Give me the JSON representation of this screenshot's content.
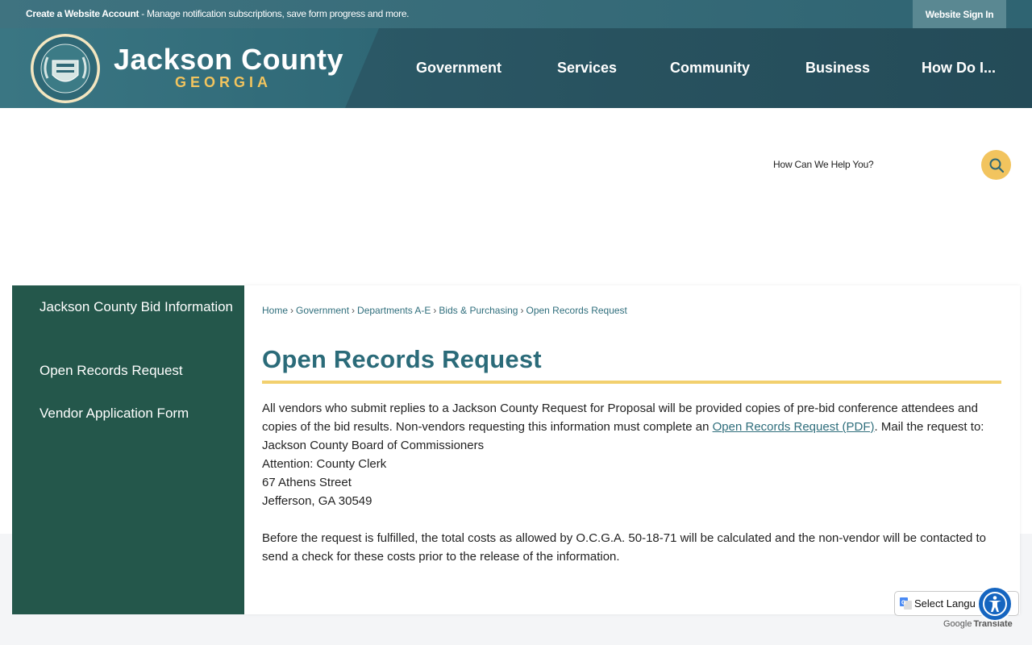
{
  "topbar": {
    "message_strong": "Create a Website Account",
    "message_rest": " - Manage notification subscriptions, save form progress and more.",
    "signin_label": "Website Sign In"
  },
  "header": {
    "brand_name": "Jackson County",
    "brand_state": "GEORGIA",
    "nav": [
      {
        "label": "Government"
      },
      {
        "label": "Services"
      },
      {
        "label": "Community"
      },
      {
        "label": "Business"
      },
      {
        "label": "How Do I..."
      }
    ]
  },
  "search": {
    "placeholder": "How Can We Help You?"
  },
  "sidebar": {
    "items": [
      {
        "label": "Jackson County Bid Information"
      },
      {
        "label": "Open Records Request"
      },
      {
        "label": "Vendor Application Form"
      }
    ]
  },
  "breadcrumb": {
    "items": [
      "Home",
      "Government",
      "Departments A-E",
      "Bids & Purchasing",
      "Open Records Request"
    ]
  },
  "content": {
    "title": "Open Records Request",
    "para1_before": "All vendors who submit replies to a Jackson County Request for Proposal will be provided copies of pre-bid conference attendees and copies of the bid results. Non-vendors requesting this information must complete an ",
    "para1_link": "Open Records Request (PDF)",
    "para1_after": ". Mail the request to:",
    "address": [
      "Jackson County Board of Commissioners",
      "Attention: County Clerk",
      "67 Athens Street",
      "Jefferson, GA 30549"
    ],
    "para2": "Before the request is fulfilled, the total costs as allowed by O.C.G.A. 50-18-71 will be calculated and the non-vendor will be contacted to send a check for these costs prior to the release of the information."
  },
  "translate": {
    "select_label": "Select Langu",
    "powered_by": "Google",
    "translate_word": "Translate"
  },
  "colors": {
    "header_teal": "#2f6170",
    "accent_gold": "#f2c45e",
    "sidebar_green": "#24574b",
    "link_teal": "#2f6e7c"
  }
}
